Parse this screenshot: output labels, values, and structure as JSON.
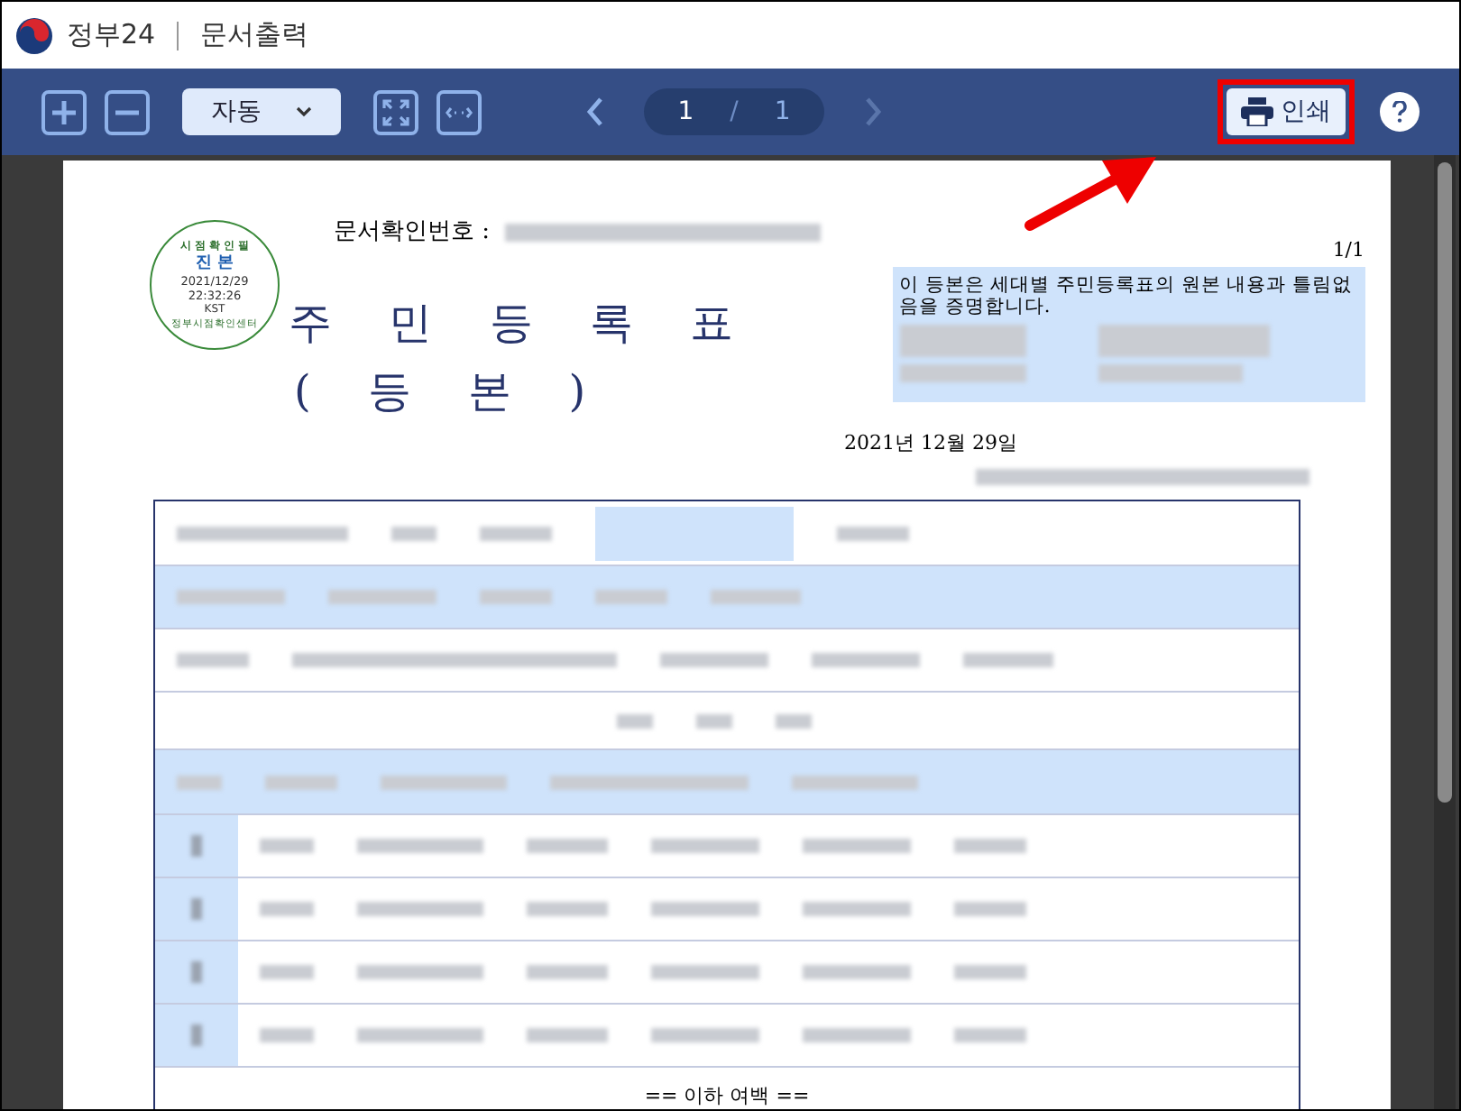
{
  "title_bar": {
    "app": "정부24",
    "section": "문서출력"
  },
  "toolbar": {
    "zoom_mode": "자동",
    "current_page": "1",
    "page_separator": "/",
    "total_pages": "1",
    "print_button": "인쇄"
  },
  "document": {
    "confirm_label": "문서확인번호 :",
    "stamp": {
      "top_arc": "시 점 확 인 필",
      "mark": "진 본",
      "date": "2021/12/29",
      "time": "22:32:26",
      "zone": "KST",
      "bottom_arc": "정부시점확인센터"
    },
    "page_number": "1/1",
    "certification": "이 등본은 세대별 주민등록표의 원본 내용과 틀림없음을 증명합니다.",
    "title": "주 민 등 록 표",
    "subtitle": "( 등 본 )",
    "date": "2021년 12월 29일",
    "footer": "== 이하 여백 =="
  }
}
